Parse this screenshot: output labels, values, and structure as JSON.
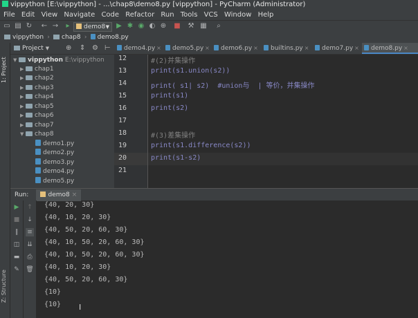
{
  "window": {
    "title": "vippython [E:\\vippython] - ...\\chap8\\demo8.py [vippython] - PyCharm (Administrator)"
  },
  "menu": [
    "File",
    "Edit",
    "View",
    "Navigate",
    "Code",
    "Refactor",
    "Run",
    "Tools",
    "VCS",
    "Window",
    "Help"
  ],
  "toolbar": {
    "run_config": "demo8"
  },
  "navbar": [
    "vippython",
    "chap8",
    "demo8.py"
  ],
  "left_strip": {
    "project_tab": "1: Project",
    "structure_tab": "Z: Structure"
  },
  "project_panel": {
    "title": "Project",
    "root": {
      "name": "vippython",
      "path": "E:\\vippython"
    },
    "folders": [
      "chap1",
      "chap2",
      "chap3",
      "chap4",
      "chap5",
      "chap6",
      "chap7",
      "chap8"
    ],
    "files": [
      "demo1.py",
      "demo2.py",
      "demo3.py",
      "demo4.py",
      "demo5.py"
    ]
  },
  "editor": {
    "tabs": [
      "demo4.py",
      "demo5.py",
      "demo6.py",
      "builtins.py",
      "demo7.py",
      "demo8.py"
    ],
    "active_tab": "demo8.py",
    "line_numbers": [
      "12",
      "13",
      "14",
      "15",
      "16",
      "17",
      "18",
      "19",
      "20",
      "21"
    ],
    "lines": [
      "#(2)并集操作",
      "print(s1.union(s2))",
      "print( s1| s2)  #union与  | 等价，并集操作",
      "print(s1)",
      "print(s2)",
      "",
      "#(3)差集操作",
      "print(s1.difference(s2))",
      "print(s1-s2)",
      ""
    ]
  },
  "run_panel": {
    "label": "Run:",
    "tab": "demo8",
    "output": [
      "{40, 20, 30}",
      "{40, 10, 20, 30}",
      "{40, 50, 20, 60, 30}",
      "{40, 10, 50, 20, 60, 30}",
      "{40, 10, 50, 20, 60, 30}",
      "{40, 10, 20, 30}",
      "{40, 50, 20, 60, 30}",
      "{10}",
      "{10}"
    ]
  },
  "colors": {
    "accent": "#4a88c7",
    "run_green": "#59a869",
    "keyword": "#8888c6",
    "comment": "#808080"
  }
}
